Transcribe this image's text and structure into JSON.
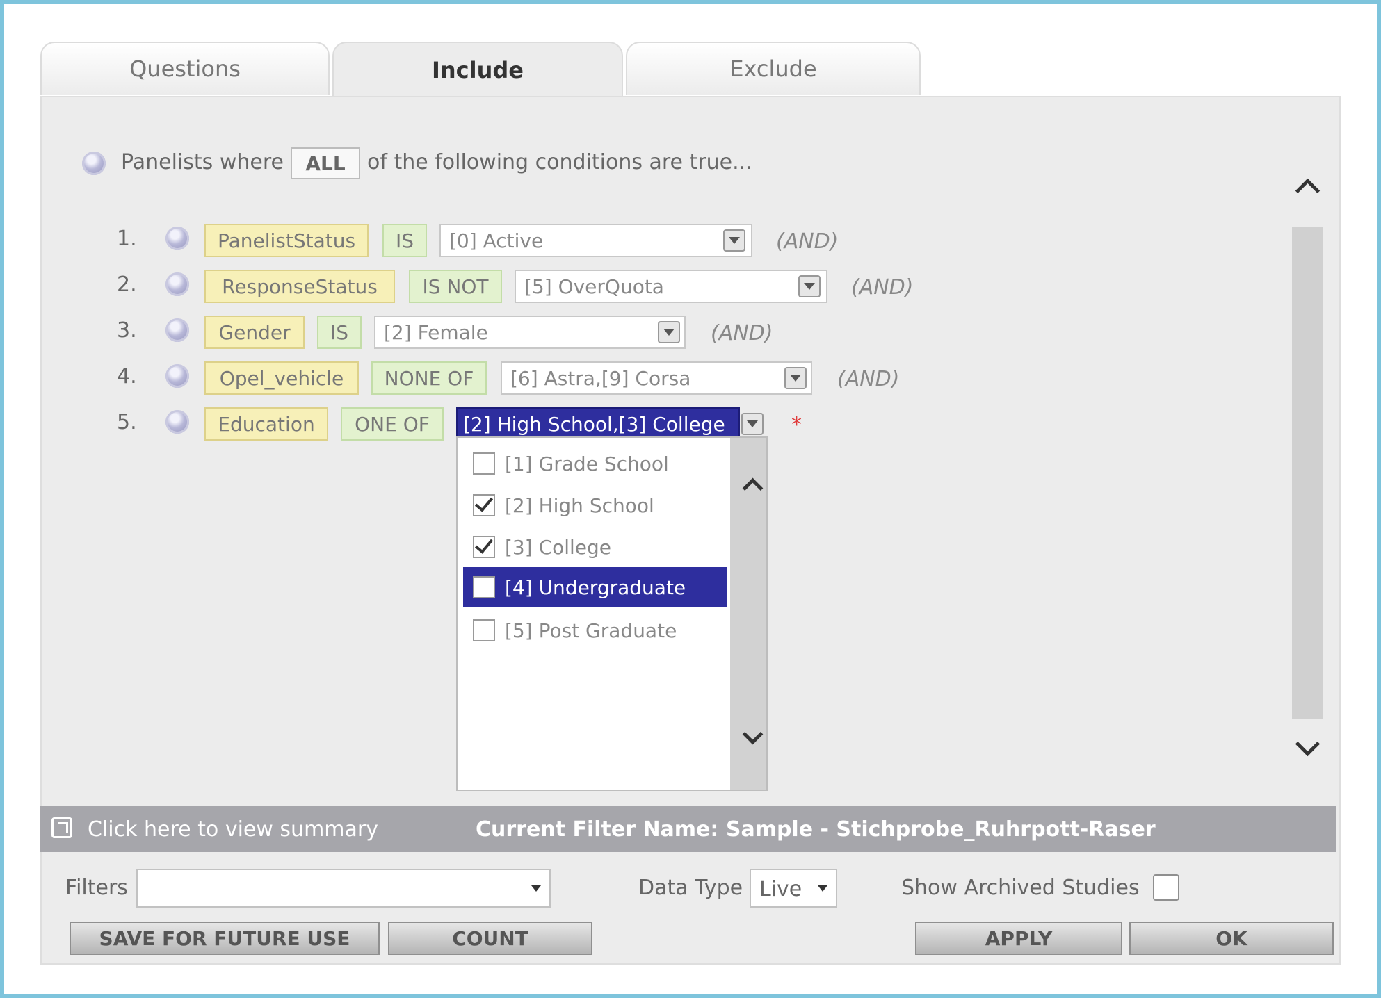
{
  "tabs": [
    {
      "label": "Questions"
    },
    {
      "label": "Include"
    },
    {
      "label": "Exclude"
    }
  ],
  "header": {
    "prefix": "Panelists where",
    "mode": "ALL",
    "suffix": "of the following conditions are true..."
  },
  "conditions": [
    {
      "num": "1.",
      "field": "PanelistStatus",
      "op": "IS",
      "value": "[0] Active",
      "conj": "(AND)"
    },
    {
      "num": "2.",
      "field": "ResponseStatus",
      "op": "IS NOT",
      "value": "[5] OverQuota",
      "conj": "(AND)"
    },
    {
      "num": "3.",
      "field": "Gender",
      "op": "IS",
      "value": "[2] Female",
      "conj": "(AND)"
    },
    {
      "num": "4.",
      "field": "Opel_vehicle",
      "op": "NONE OF",
      "value": "[6] Astra,[9] Corsa",
      "conj": "(AND)"
    },
    {
      "num": "5.",
      "field": "Education",
      "op": "ONE OF",
      "value": "[2] High School,[3] College",
      "conj": "*"
    }
  ],
  "options": [
    {
      "label": "[1] Grade School",
      "checked": false,
      "highlighted": false
    },
    {
      "label": "[2] High School",
      "checked": true,
      "highlighted": false
    },
    {
      "label": "[3] College",
      "checked": true,
      "highlighted": false
    },
    {
      "label": "[4] Undergraduate",
      "checked": false,
      "highlighted": true
    },
    {
      "label": "[5] Post Graduate",
      "checked": false,
      "highlighted": false
    }
  ],
  "summary": {
    "link": "Click here to view summary",
    "filter_name": "Current Filter Name: Sample - Stichprobe_Ruhrpott-Raser"
  },
  "filters": {
    "label": "Filters",
    "value": ""
  },
  "data_type": {
    "label": "Data Type",
    "value": "Live"
  },
  "archived": {
    "label": "Show Archived Studies",
    "checked": false
  },
  "buttons": {
    "save": "SAVE FOR FUTURE USE",
    "count": "COUNT",
    "apply": "APPLY",
    "ok": "OK"
  }
}
